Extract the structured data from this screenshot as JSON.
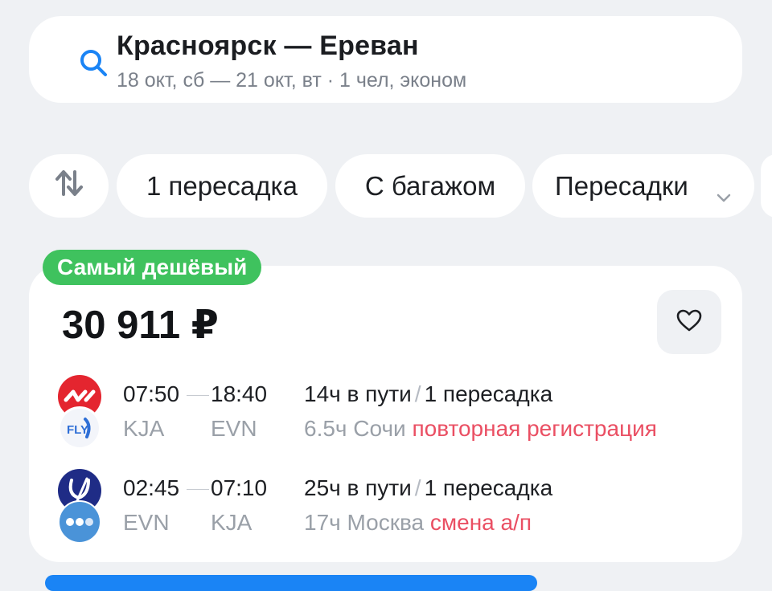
{
  "search": {
    "route": "Красноярск — Ереван",
    "details": "18 окт, сб — 21 окт, вт · 1 чел, эконом",
    "icon": "search-icon"
  },
  "filters": {
    "sort_icon": "sort-arrows-icon",
    "chips": [
      "1 пересадка",
      "С багажом",
      "Пересадки"
    ],
    "dropdown_icon": "chevron-down-icon"
  },
  "offer": {
    "badge": "Самый дешёвый",
    "price": "30 911 ₽",
    "favorite_icon": "heart-icon",
    "segments": [
      {
        "dep_time": "07:50",
        "arr_time": "18:40",
        "dep_code": "KJA",
        "arr_code": "EVN",
        "duration": "14ч в пути",
        "slash": "/",
        "transfers": "1 пересадка",
        "stop": "6.5ч Сочи",
        "warning": "повторная регистрация",
        "logos": [
          "red-airline-logo",
          "fly-airline-logo"
        ]
      },
      {
        "dep_time": "02:45",
        "arr_time": "07:10",
        "dep_code": "EVN",
        "arr_code": "KJA",
        "duration": "25ч в пути",
        "slash": "/",
        "transfers": "1 пересадка",
        "stop": "17ч Москва",
        "warning": "смена а/п",
        "logos": [
          "navy-airline-logo",
          "blue-dots-airline-logo"
        ]
      }
    ]
  },
  "colors": {
    "background": "#eff1f4",
    "badge_green": "#3fc25e",
    "warning_red": "#ea4f63",
    "accent_blue": "#1a84f5"
  }
}
